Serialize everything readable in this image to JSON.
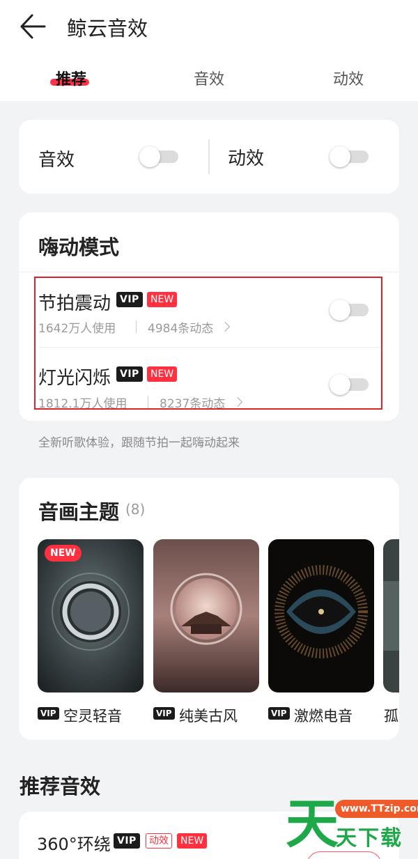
{
  "header": {
    "title": "鲸云音效",
    "tabs": [
      {
        "label": "推荐",
        "active": true
      },
      {
        "label": "音效",
        "active": false
      },
      {
        "label": "动效",
        "active": false
      }
    ]
  },
  "toggles_card": {
    "sound_label": "音效",
    "motion_label": "动效",
    "sound_on": false,
    "motion_on": false
  },
  "hi_mode": {
    "title": "嗨动模式",
    "items": [
      {
        "title": "节拍震动",
        "vip": "VIP",
        "new": "NEW",
        "users": "1642万人使用",
        "posts": "4984条动态",
        "on": false
      },
      {
        "title": "灯光闪烁",
        "vip": "VIP",
        "new": "NEW",
        "users": "1812.1万人使用",
        "posts": "8237条动态",
        "on": false
      }
    ],
    "caption": "全新听歌体验，跟随节拍一起嗨动起来"
  },
  "themes": {
    "title": "音画主题",
    "count": "(8)",
    "items": [
      {
        "label": "空灵轻音",
        "vip": "VIP",
        "badge": "NEW"
      },
      {
        "label": "纯美古风",
        "vip": "VIP"
      },
      {
        "label": "激燃电音",
        "vip": "VIP"
      },
      {
        "label": "孤"
      }
    ]
  },
  "recommended": {
    "title": "推荐音效",
    "first_item": {
      "title": "360°环绕",
      "vip": "VIP",
      "tag": "动效",
      "new": "NEW"
    }
  },
  "watermark": {
    "url": "www.TTzip.com",
    "big_char": "天",
    "small_text": "天下载"
  },
  "colors": {
    "accent": "#ff3040",
    "highlight_box": "#d8242a",
    "watermark_green": "#1fa84a",
    "watermark_orange": "#f05a28"
  }
}
